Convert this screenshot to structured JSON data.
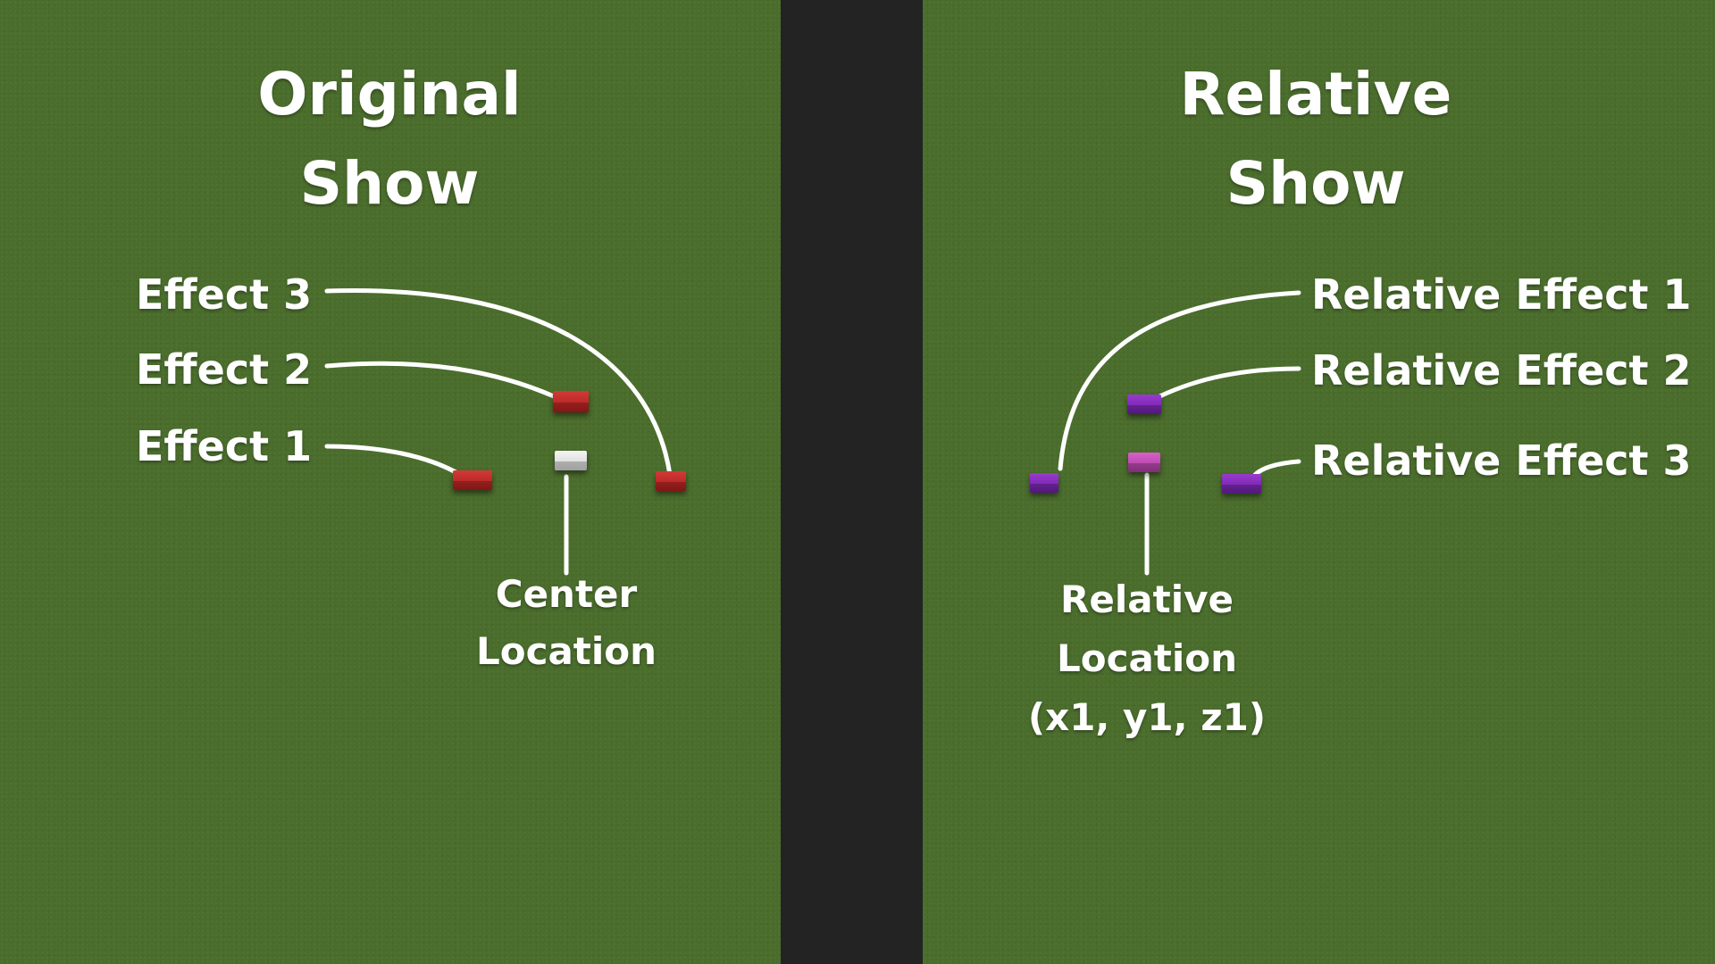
{
  "left": {
    "title_line1": "Original",
    "title_line2": "Show",
    "effect3": "Effect 3",
    "effect2": "Effect 2",
    "effect1": "Effect 1",
    "center_line1": "Center",
    "center_line2": "Location"
  },
  "right": {
    "title_line1": "Relative",
    "title_line2": "Show",
    "effect1": "Relative Effect 1",
    "effect2": "Relative Effect 2",
    "effect3": "Relative Effect 3",
    "location_line1": "Relative",
    "location_line2": "Location",
    "location_line3": "(x1, y1, z1)"
  },
  "colors": {
    "grass": "#4a6d2c",
    "divider": "#232323",
    "original_effect_block": "#c12a27",
    "center_block": "#e8e8e8",
    "relative_effect_block": "#8a2ec0",
    "relative_location_block": "#c34db6"
  }
}
